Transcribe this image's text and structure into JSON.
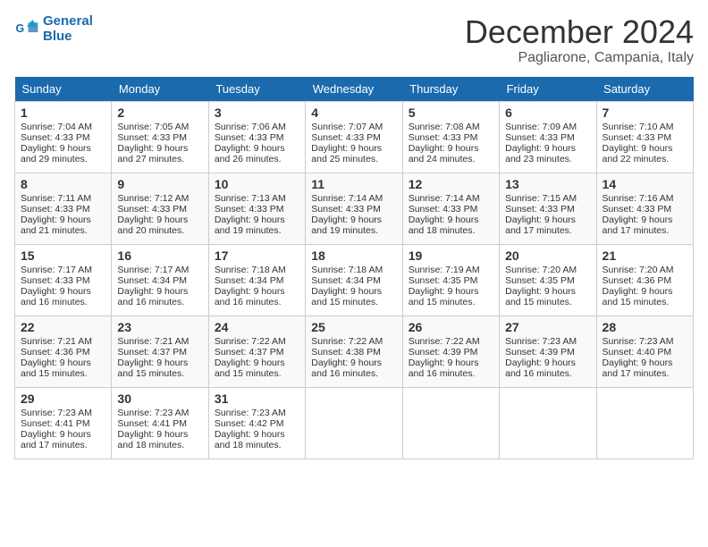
{
  "header": {
    "logo_line1": "General",
    "logo_line2": "Blue",
    "month": "December 2024",
    "location": "Pagliarone, Campania, Italy"
  },
  "days_of_week": [
    "Sunday",
    "Monday",
    "Tuesday",
    "Wednesday",
    "Thursday",
    "Friday",
    "Saturday"
  ],
  "weeks": [
    [
      {
        "day": "1",
        "sunrise": "7:04 AM",
        "sunset": "4:33 PM",
        "daylight": "9 hours and 29 minutes."
      },
      {
        "day": "2",
        "sunrise": "7:05 AM",
        "sunset": "4:33 PM",
        "daylight": "9 hours and 27 minutes."
      },
      {
        "day": "3",
        "sunrise": "7:06 AM",
        "sunset": "4:33 PM",
        "daylight": "9 hours and 26 minutes."
      },
      {
        "day": "4",
        "sunrise": "7:07 AM",
        "sunset": "4:33 PM",
        "daylight": "9 hours and 25 minutes."
      },
      {
        "day": "5",
        "sunrise": "7:08 AM",
        "sunset": "4:33 PM",
        "daylight": "9 hours and 24 minutes."
      },
      {
        "day": "6",
        "sunrise": "7:09 AM",
        "sunset": "4:33 PM",
        "daylight": "9 hours and 23 minutes."
      },
      {
        "day": "7",
        "sunrise": "7:10 AM",
        "sunset": "4:33 PM",
        "daylight": "9 hours and 22 minutes."
      }
    ],
    [
      {
        "day": "8",
        "sunrise": "7:11 AM",
        "sunset": "4:33 PM",
        "daylight": "9 hours and 21 minutes."
      },
      {
        "day": "9",
        "sunrise": "7:12 AM",
        "sunset": "4:33 PM",
        "daylight": "9 hours and 20 minutes."
      },
      {
        "day": "10",
        "sunrise": "7:13 AM",
        "sunset": "4:33 PM",
        "daylight": "9 hours and 19 minutes."
      },
      {
        "day": "11",
        "sunrise": "7:14 AM",
        "sunset": "4:33 PM",
        "daylight": "9 hours and 19 minutes."
      },
      {
        "day": "12",
        "sunrise": "7:14 AM",
        "sunset": "4:33 PM",
        "daylight": "9 hours and 18 minutes."
      },
      {
        "day": "13",
        "sunrise": "7:15 AM",
        "sunset": "4:33 PM",
        "daylight": "9 hours and 17 minutes."
      },
      {
        "day": "14",
        "sunrise": "7:16 AM",
        "sunset": "4:33 PM",
        "daylight": "9 hours and 17 minutes."
      }
    ],
    [
      {
        "day": "15",
        "sunrise": "7:17 AM",
        "sunset": "4:33 PM",
        "daylight": "9 hours and 16 minutes."
      },
      {
        "day": "16",
        "sunrise": "7:17 AM",
        "sunset": "4:34 PM",
        "daylight": "9 hours and 16 minutes."
      },
      {
        "day": "17",
        "sunrise": "7:18 AM",
        "sunset": "4:34 PM",
        "daylight": "9 hours and 16 minutes."
      },
      {
        "day": "18",
        "sunrise": "7:18 AM",
        "sunset": "4:34 PM",
        "daylight": "9 hours and 15 minutes."
      },
      {
        "day": "19",
        "sunrise": "7:19 AM",
        "sunset": "4:35 PM",
        "daylight": "9 hours and 15 minutes."
      },
      {
        "day": "20",
        "sunrise": "7:20 AM",
        "sunset": "4:35 PM",
        "daylight": "9 hours and 15 minutes."
      },
      {
        "day": "21",
        "sunrise": "7:20 AM",
        "sunset": "4:36 PM",
        "daylight": "9 hours and 15 minutes."
      }
    ],
    [
      {
        "day": "22",
        "sunrise": "7:21 AM",
        "sunset": "4:36 PM",
        "daylight": "9 hours and 15 minutes."
      },
      {
        "day": "23",
        "sunrise": "7:21 AM",
        "sunset": "4:37 PM",
        "daylight": "9 hours and 15 minutes."
      },
      {
        "day": "24",
        "sunrise": "7:22 AM",
        "sunset": "4:37 PM",
        "daylight": "9 hours and 15 minutes."
      },
      {
        "day": "25",
        "sunrise": "7:22 AM",
        "sunset": "4:38 PM",
        "daylight": "9 hours and 16 minutes."
      },
      {
        "day": "26",
        "sunrise": "7:22 AM",
        "sunset": "4:39 PM",
        "daylight": "9 hours and 16 minutes."
      },
      {
        "day": "27",
        "sunrise": "7:23 AM",
        "sunset": "4:39 PM",
        "daylight": "9 hours and 16 minutes."
      },
      {
        "day": "28",
        "sunrise": "7:23 AM",
        "sunset": "4:40 PM",
        "daylight": "9 hours and 17 minutes."
      }
    ],
    [
      {
        "day": "29",
        "sunrise": "7:23 AM",
        "sunset": "4:41 PM",
        "daylight": "9 hours and 17 minutes."
      },
      {
        "day": "30",
        "sunrise": "7:23 AM",
        "sunset": "4:41 PM",
        "daylight": "9 hours and 18 minutes."
      },
      {
        "day": "31",
        "sunrise": "7:23 AM",
        "sunset": "4:42 PM",
        "daylight": "9 hours and 18 minutes."
      },
      null,
      null,
      null,
      null
    ]
  ],
  "labels": {
    "sunrise": "Sunrise:",
    "sunset": "Sunset:",
    "daylight": "Daylight:"
  }
}
